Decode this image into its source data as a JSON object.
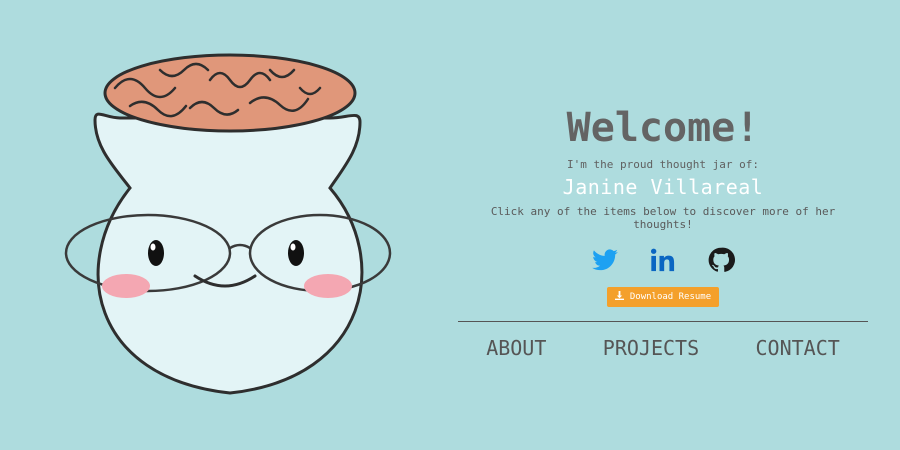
{
  "hero": {
    "title": "Welcome!",
    "subtitle": "I'm the proud thought jar of:",
    "name": "Janine Villareal",
    "intro": "Click any of the items below to discover more of her thoughts!"
  },
  "socials": [
    {
      "icon": "twitter-icon",
      "color": "#1da1f2"
    },
    {
      "icon": "linkedin-icon",
      "color": "#0a66c2"
    },
    {
      "icon": "github-icon",
      "color": "#1b1b1b"
    }
  ],
  "resume": {
    "label": "Download Resume",
    "icon": "download-icon",
    "color": "#f4a02b"
  },
  "nav": {
    "about": "ABOUT",
    "projects": "PROJECTS",
    "contact": "CONTACT"
  },
  "colors": {
    "background": "#aedcde",
    "brain": "#e0977a",
    "jar": "#e3f4f6",
    "cheek": "#f4a7b2"
  }
}
